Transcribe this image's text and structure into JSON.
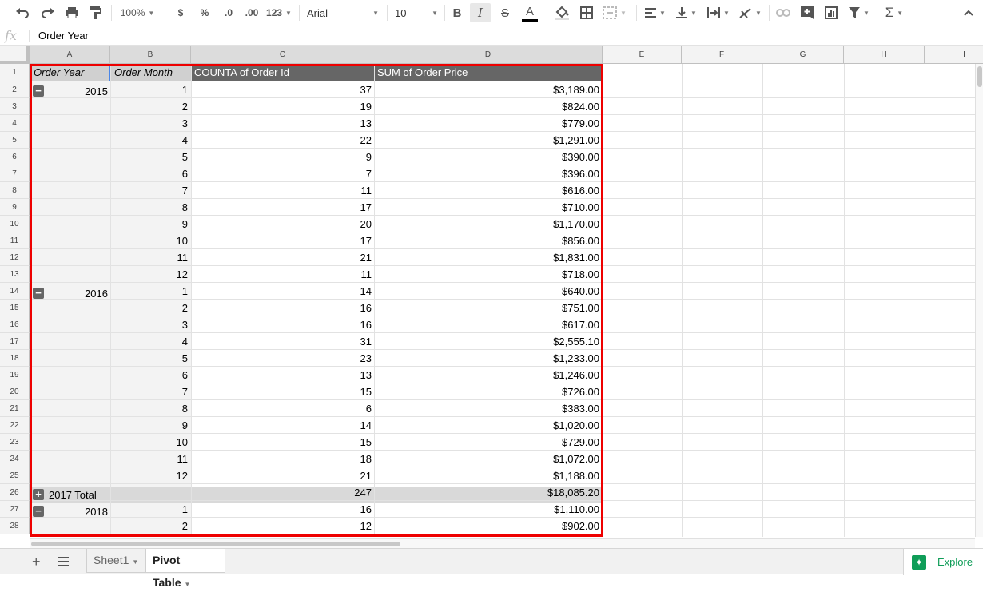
{
  "toolbar": {
    "zoom": "100%",
    "currency": "$",
    "percent": "%",
    "decrease_decimals": ".0",
    "increase_decimals": ".00",
    "more_formats": "123",
    "font": "Arial",
    "font_size": "10",
    "bold": "B",
    "italic": "I",
    "strikethrough": "S",
    "text_color": "A"
  },
  "formula_bar": {
    "fx": "fx",
    "content": "Order Year"
  },
  "columns": [
    "A",
    "B",
    "C",
    "D",
    "E",
    "F",
    "G",
    "H",
    "I"
  ],
  "rows": [
    "1",
    "2",
    "3",
    "4",
    "5",
    "6",
    "7",
    "8",
    "9",
    "10",
    "11",
    "12",
    "13",
    "14",
    "15",
    "16",
    "17",
    "18",
    "19",
    "20",
    "21",
    "22",
    "23",
    "24",
    "25",
    "26",
    "27",
    "28"
  ],
  "pivot": {
    "headers": {
      "a": "Order Year",
      "b": "Order Month",
      "c": "COUNTA of Order Id",
      "d": "SUM of Order Price"
    },
    "groups": {
      "g2015": "2015",
      "g2016": "2016",
      "g2017_total": "2017 Total",
      "g2018": "2018"
    },
    "data_rows": [
      {
        "month": "1",
        "count": "37",
        "sum": "$3,189.00"
      },
      {
        "month": "2",
        "count": "19",
        "sum": "$824.00"
      },
      {
        "month": "3",
        "count": "13",
        "sum": "$779.00"
      },
      {
        "month": "4",
        "count": "22",
        "sum": "$1,291.00"
      },
      {
        "month": "5",
        "count": "9",
        "sum": "$390.00"
      },
      {
        "month": "6",
        "count": "7",
        "sum": "$396.00"
      },
      {
        "month": "7",
        "count": "11",
        "sum": "$616.00"
      },
      {
        "month": "8",
        "count": "17",
        "sum": "$710.00"
      },
      {
        "month": "9",
        "count": "20",
        "sum": "$1,170.00"
      },
      {
        "month": "10",
        "count": "17",
        "sum": "$856.00"
      },
      {
        "month": "11",
        "count": "21",
        "sum": "$1,831.00"
      },
      {
        "month": "12",
        "count": "11",
        "sum": "$718.00"
      },
      {
        "month": "1",
        "count": "14",
        "sum": "$640.00"
      },
      {
        "month": "2",
        "count": "16",
        "sum": "$751.00"
      },
      {
        "month": "3",
        "count": "16",
        "sum": "$617.00"
      },
      {
        "month": "4",
        "count": "31",
        "sum": "$2,555.10"
      },
      {
        "month": "5",
        "count": "23",
        "sum": "$1,233.00"
      },
      {
        "month": "6",
        "count": "13",
        "sum": "$1,246.00"
      },
      {
        "month": "7",
        "count": "15",
        "sum": "$726.00"
      },
      {
        "month": "8",
        "count": "6",
        "sum": "$383.00"
      },
      {
        "month": "9",
        "count": "14",
        "sum": "$1,020.00"
      },
      {
        "month": "10",
        "count": "15",
        "sum": "$729.00"
      },
      {
        "month": "11",
        "count": "18",
        "sum": "$1,072.00"
      },
      {
        "month": "12",
        "count": "21",
        "sum": "$1,188.00"
      },
      {
        "month": "",
        "count": "247",
        "sum": "$18,085.20"
      },
      {
        "month": "1",
        "count": "16",
        "sum": "$1,110.00"
      },
      {
        "month": "2",
        "count": "12",
        "sum": "$902.00"
      }
    ]
  },
  "sheets": {
    "add": "+",
    "sheet1": "Sheet1",
    "pivot_table": "Pivot Table"
  },
  "explore": {
    "label": "Explore"
  },
  "colors": {
    "highlight_border": "#e00000",
    "header_fill": "#666666",
    "total_fill": "#d9d9d9",
    "explore": "#0f9d58"
  }
}
